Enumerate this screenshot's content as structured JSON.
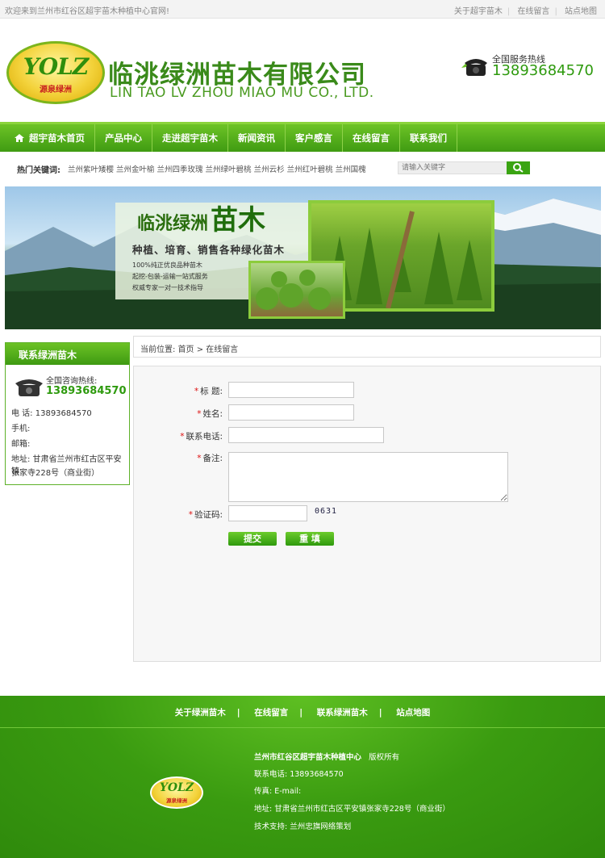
{
  "topbar": {
    "welcome": "欢迎来到兰州市红谷区超宇苗木种植中心官网!",
    "links": [
      "关于超宇苗木",
      "在线留言",
      "站点地图"
    ]
  },
  "header": {
    "logo_text": "YOLZ",
    "logo_sub": "源泉绿洲",
    "company_cn": "临洮绿洲苗木有限公司",
    "company_en": "LIN TAO LV ZHOU MIAO MU CO., LTD.",
    "hotline_label": "全国服务热线",
    "hotline_number": "13893684570"
  },
  "nav": {
    "items": [
      "超宇苗木首页",
      "产品中心",
      "走进超宇苗木",
      "新闻资讯",
      "客户感言",
      "在线留言",
      "联系我们"
    ]
  },
  "keywords": {
    "label": "热门关键词:",
    "items": "兰州紫叶矮樱 兰州金叶榆 兰州四季玫瑰 兰州绿叶碧桃 兰州云杉 兰州红叶碧桃 兰州国槐",
    "search_placeholder": "请输入关键字"
  },
  "banner": {
    "title": "临洮绿洲",
    "title_big": "苗木",
    "subtitle": "种植、培育、销售各种绿化苗木",
    "bullets": [
      "100%纯正优良品种苗木",
      "起挖-包装-运输一站式服务",
      "权威专家一对一技术指导"
    ]
  },
  "sidebar": {
    "title": "联系绿洲苗木",
    "hotline_label": "全国咨询热线:",
    "hotline_number": "13893684570",
    "phone": "电 话: 13893684570",
    "mobile": "手机:",
    "email": "邮箱:",
    "address_1": "地址: 甘肃省兰州市红古区平安镇",
    "address_2": "张家寺228号（商业街）"
  },
  "breadcrumb": "当前位置: 首页 > 在线留言",
  "form": {
    "title_label": "标 题:",
    "name_label": "姓名:",
    "phone_label": "联系电话:",
    "remark_label": "备注:",
    "captcha_label": "验证码:",
    "captcha_code": "0631",
    "submit": "提交",
    "reset": "重 填"
  },
  "footer": {
    "links": [
      "关于绿洲苗木",
      "在线留言",
      "联系绿洲苗木",
      "站点地图"
    ],
    "company": "兰州市红谷区超宇苗木种植中心",
    "rights": "版权所有",
    "phone": "联系电话: 13893684570",
    "fax_email": "传真:      E-mail:",
    "address": "地址: 甘肃省兰州市红古区平安镇张家寺228号（商业街）",
    "support": "技术支持: 兰州忠旗网络策划"
  },
  "colors": {
    "brand_green": "#3f9b12",
    "accent_red": "#d11111"
  }
}
